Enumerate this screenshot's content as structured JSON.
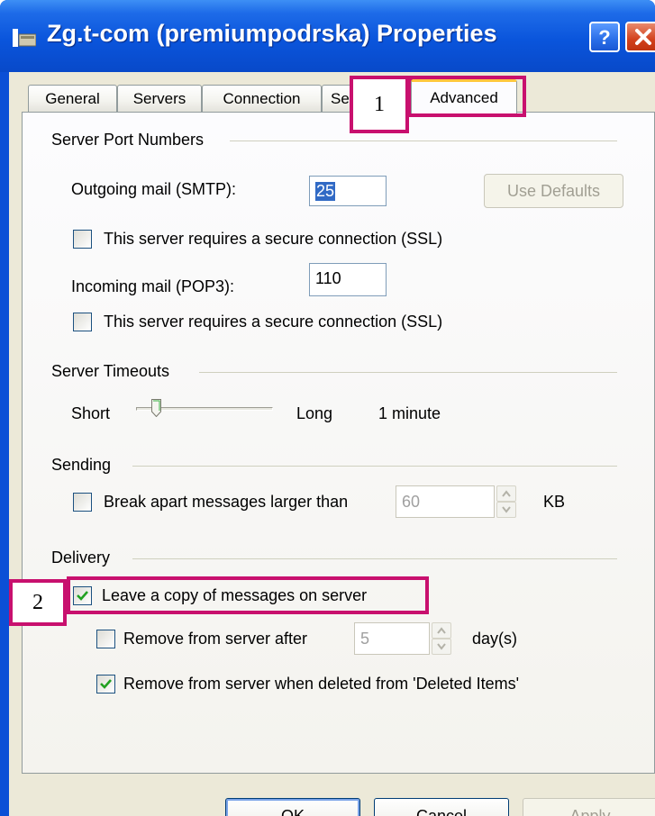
{
  "window": {
    "title": "Zg.t-com (premiumpodrska) Properties",
    "help_icon": "help-icon",
    "close_icon": "close-icon"
  },
  "tabs": [
    {
      "label": "General",
      "active": false
    },
    {
      "label": "Servers",
      "active": false
    },
    {
      "label": "Connection",
      "active": false
    },
    {
      "label": "Se",
      "active": false
    },
    {
      "label": "Advanced",
      "active": true
    }
  ],
  "ports": {
    "heading": "Server Port Numbers",
    "smtp_label": "Outgoing mail (SMTP):",
    "smtp_value": "25",
    "use_defaults": "Use Defaults",
    "ssl_smtp_label": "This server requires a secure connection (SSL)",
    "ssl_smtp_checked": false,
    "pop3_label": "Incoming mail (POP3):",
    "pop3_value": "110",
    "ssl_pop3_label": "This server requires a secure connection (SSL)",
    "ssl_pop3_checked": false
  },
  "timeouts": {
    "heading": "Server Timeouts",
    "short_label": "Short",
    "long_label": "Long",
    "value_text": "1 minute",
    "slider_position": 0.13
  },
  "sending": {
    "heading": "Sending",
    "break_label": "Break apart messages larger than",
    "break_checked": false,
    "break_value": "60",
    "unit": "KB"
  },
  "delivery": {
    "heading": "Delivery",
    "leave_copy_label": "Leave a copy of messages on server",
    "leave_copy_checked": true,
    "remove_after_label": "Remove from server after",
    "remove_after_checked": false,
    "remove_after_value": "5",
    "days_label": "day(s)",
    "remove_deleted_label": "Remove from server when deleted from 'Deleted Items'",
    "remove_deleted_checked": true
  },
  "buttons": {
    "ok": "OK",
    "cancel": "Cancel",
    "apply": "Apply"
  },
  "annotations": {
    "marker_1": "1",
    "marker_2": "2",
    "color": "#c8106e"
  }
}
